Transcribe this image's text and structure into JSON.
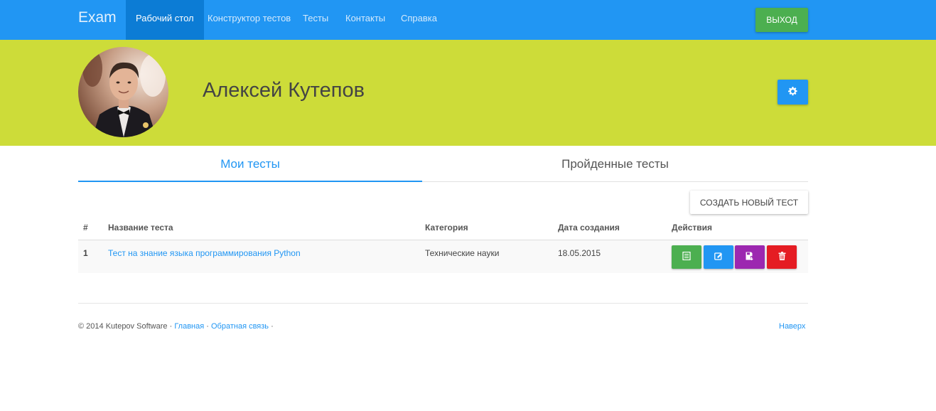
{
  "navbar": {
    "brand": "Exam",
    "items": [
      {
        "label": "Рабочий стол",
        "active": true
      },
      {
        "label": "Конструктор тестов",
        "active": false
      },
      {
        "label": "Тесты",
        "active": false
      },
      {
        "label": "Контакты",
        "active": false
      },
      {
        "label": "Справка",
        "active": false
      }
    ],
    "logout_label": "ВЫХОД"
  },
  "profile": {
    "name": "Алексей Кутепов",
    "settings_icon": "gear-icon"
  },
  "tabs": [
    {
      "label": "Мои тесты",
      "active": true
    },
    {
      "label": "Пройденные тесты",
      "active": false
    }
  ],
  "create_button_label": "СОЗДАТЬ НОВЫЙ ТЕСТ",
  "table": {
    "headers": [
      "#",
      "Название теста",
      "Категория",
      "Дата создания",
      "Действия"
    ],
    "rows": [
      {
        "num": "1",
        "title": "Тест на знание языка программирования Python",
        "category": "Технические науки",
        "date": "18.05.2015",
        "actions": [
          {
            "icon": "list-icon",
            "color": "#4caf50"
          },
          {
            "icon": "edit-icon",
            "color": "#2196f3"
          },
          {
            "icon": "save-icon",
            "color": "#9c27b0"
          },
          {
            "icon": "trash-icon",
            "color": "#e51c23"
          }
        ]
      }
    ]
  },
  "footer": {
    "copyright": "© 2014 Kutepov Software ·",
    "links": [
      "Главная",
      "Обратная связь"
    ],
    "separator": "·",
    "top_link": "Наверх"
  },
  "colors": {
    "primary": "#2196f3",
    "banner": "#cddc39",
    "success": "#4caf50"
  }
}
